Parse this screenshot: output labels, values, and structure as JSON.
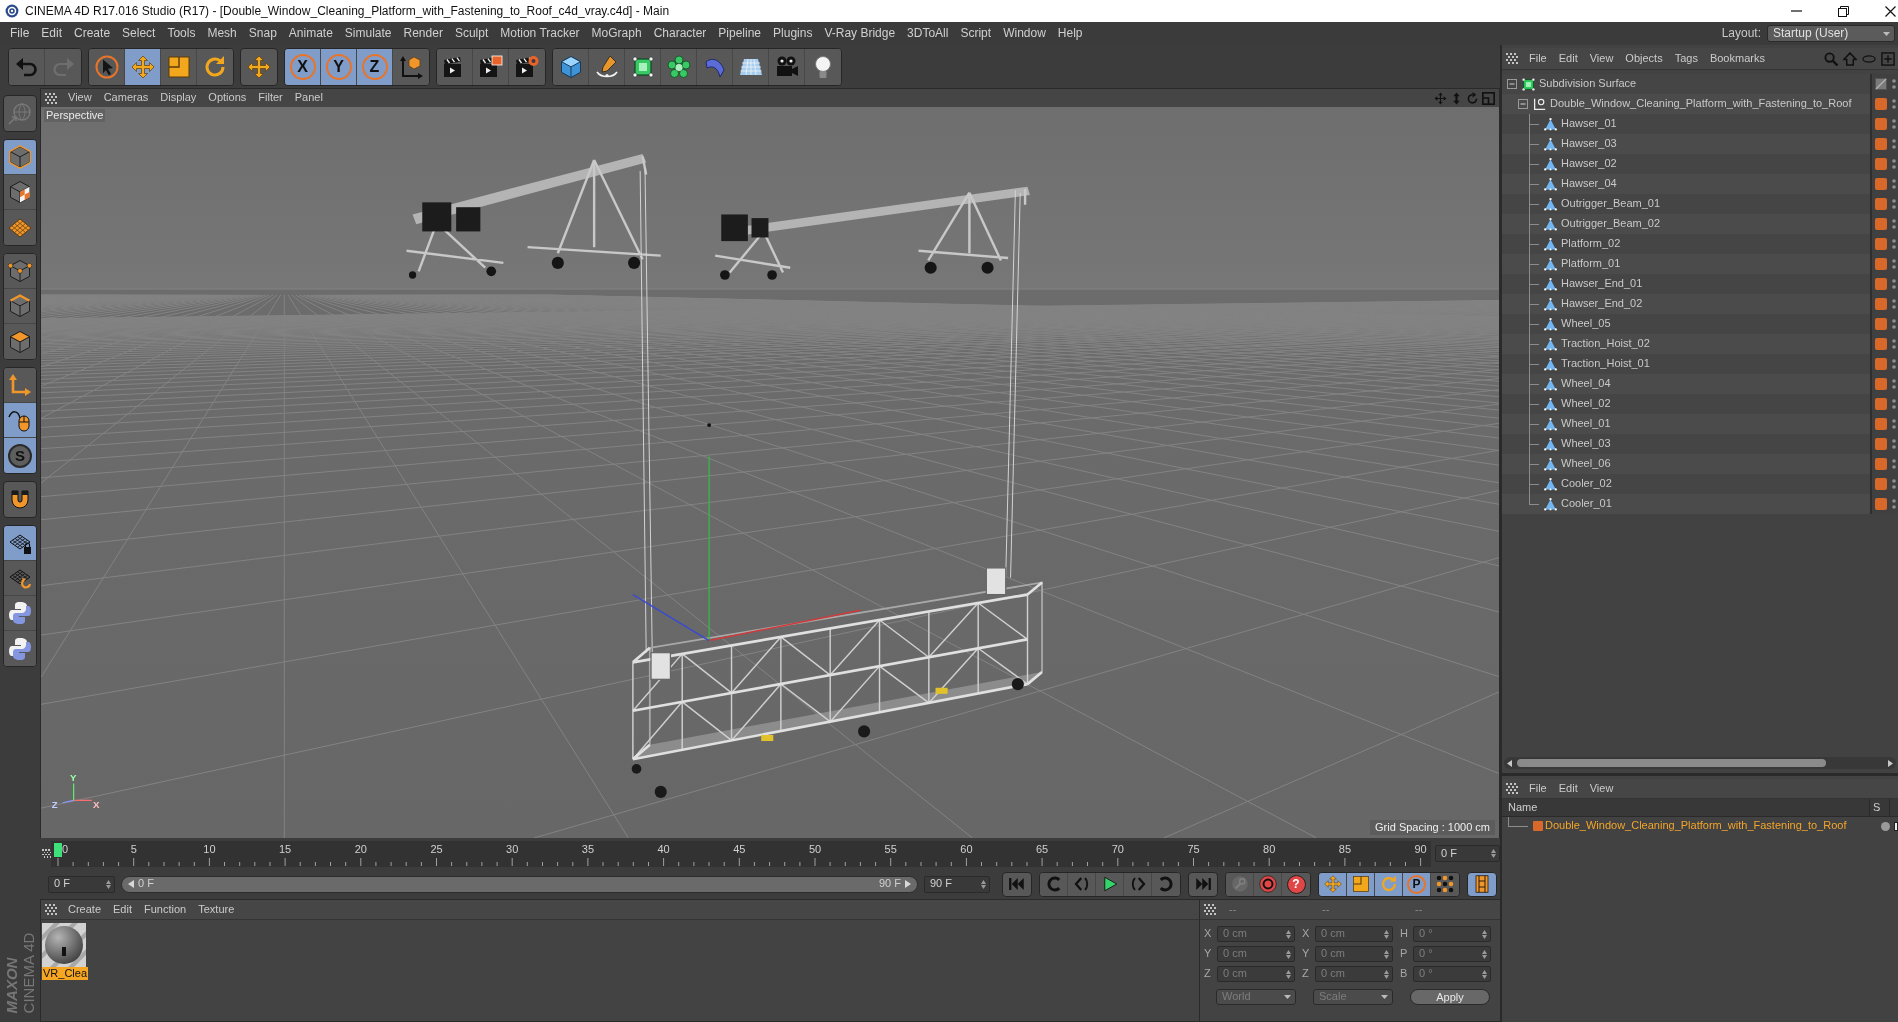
{
  "window": {
    "title": "CINEMA 4D R17.016 Studio (R17) - [Double_Window_Cleaning_Platform_with_Fastening_to_Roof_c4d_vray.c4d] - Main"
  },
  "menu_bar": {
    "items": [
      "File",
      "Edit",
      "Create",
      "Select",
      "Tools",
      "Mesh",
      "Snap",
      "Animate",
      "Simulate",
      "Render",
      "Sculpt",
      "Motion Tracker",
      "MoGraph",
      "Character",
      "Pipeline",
      "Plugins",
      "V-Ray Bridge",
      "3DToAll",
      "Script",
      "Window",
      "Help"
    ],
    "layout_label": "Layout:",
    "layout_value": "Startup (User)"
  },
  "toolbar": [
    {
      "buttons": [
        {
          "disabled": false
        },
        {
          "disabled": true
        }
      ]
    },
    {
      "buttons": [
        {
          "selected": false
        },
        {
          "selected": true
        },
        {
          "selected": false
        },
        {
          "selected": false
        }
      ]
    },
    {
      "buttons": [
        {
          "selected": false
        }
      ]
    },
    {
      "buttons": [
        {
          "label": "X",
          "selected": true
        },
        {
          "label": "Y",
          "selected": true
        },
        {
          "label": "Z",
          "selected": true
        },
        {
          "selected": false
        }
      ]
    },
    {
      "buttons": [
        {
          "selected": false
        },
        {
          "selected": false
        },
        {
          "selected": false
        }
      ]
    },
    {
      "buttons": [
        {
          "selected": false
        },
        {
          "selected": false
        },
        {
          "selected": false
        },
        {
          "selected": false
        },
        {
          "selected": false
        },
        {
          "selected": false
        },
        {
          "selected": false
        },
        {
          "selected": false
        }
      ]
    }
  ],
  "mode_toolbar": [
    {
      "buttons": [
        {
          "disabled": true
        }
      ]
    },
    {
      "buttons": [
        {
          "selected": true
        },
        {
          "selected": false
        },
        {
          "selected": false
        }
      ]
    },
    {
      "buttons": [
        {
          "selected": false
        },
        {
          "selected": false
        },
        {
          "selected": false
        }
      ]
    },
    {
      "buttons": [
        {
          "selected": false
        },
        {
          "selected": true
        },
        {
          "label": "S",
          "selected": true
        }
      ]
    },
    {
      "buttons": [
        {
          "selected": false
        }
      ]
    },
    {
      "buttons": [
        {
          "selected": true
        },
        {
          "selected": false
        },
        {
          "selected": false
        },
        {
          "selected": false
        }
      ]
    }
  ],
  "viewport": {
    "menu": [
      "View",
      "Cameras",
      "Display",
      "Options",
      "Filter",
      "Panel"
    ],
    "camera": "Perspective",
    "grid_spacing": "Grid Spacing : 1000 cm",
    "axis_labels": [
      "Y",
      "Z",
      "X"
    ]
  },
  "timeline": {
    "ticks": [
      "0",
      "5",
      "10",
      "15",
      "20",
      "25",
      "30",
      "35",
      "40",
      "45",
      "50",
      "55",
      "60",
      "65",
      "70",
      "75",
      "80",
      "85",
      "90"
    ],
    "playhead": {
      "level": 0
    },
    "current": "0 F"
  },
  "transport": {
    "start": "0 F",
    "range": {
      "start": "0 F",
      "end": "90 F"
    },
    "end": "90 F",
    "groups": [
      {
        "buttons": [
          {
            "selected": false
          }
        ]
      },
      {
        "buttons": [
          {
            "selected": false
          },
          {
            "selected": false
          },
          {
            "selected": false
          },
          {
            "selected": false
          },
          {
            "selected": false
          }
        ]
      },
      {
        "buttons": [
          {
            "selected": false
          }
        ]
      },
      {
        "buttons": [
          {
            "disabled": true
          },
          {
            "disabled": false
          },
          {
            "label": "?",
            "disabled": false
          }
        ]
      },
      {
        "buttons": [
          {
            "selected": true
          },
          {
            "selected": true
          },
          {
            "selected": true
          },
          {
            "label": "P",
            "selected": true
          },
          {
            "selected": false
          }
        ]
      },
      {
        "buttons": [
          {
            "selected": true
          }
        ]
      }
    ]
  },
  "material_manager": {
    "menu": [
      "Create",
      "Edit",
      "Function",
      "Texture"
    ],
    "materials": [
      {
        "name": "VR_Clea",
        "selected": true
      }
    ]
  },
  "coordinates": {
    "headers": [
      "--",
      "--",
      "--"
    ],
    "rows": [
      {
        "cells": [
          {
            "axis": "X",
            "value": "0 cm"
          },
          {
            "axis": "X",
            "value": "0 cm"
          },
          {
            "axis": "H",
            "value": "0 °"
          }
        ]
      },
      {
        "cells": [
          {
            "axis": "Y",
            "value": "0 cm"
          },
          {
            "axis": "Y",
            "value": "0 cm"
          },
          {
            "axis": "P",
            "value": "0 °"
          }
        ]
      },
      {
        "cells": [
          {
            "axis": "Z",
            "value": "0 cm"
          },
          {
            "axis": "Z",
            "value": "0 cm"
          },
          {
            "axis": "B",
            "value": "0 °"
          }
        ]
      }
    ],
    "modes": [
      "World",
      "Scale"
    ],
    "apply": "Apply"
  },
  "logo": {
    "brand": "MAXON",
    "product": "CINEMA 4D"
  },
  "object_manager": {
    "menu": [
      "File",
      "Edit",
      "View",
      "Objects",
      "Tags",
      "Bookmarks"
    ],
    "objects": [
      {
        "name": "Subdivision Surface",
        "kind": "generator",
        "expanded": true,
        "layer": false,
        "children": [
          {
            "name": "Double_Window_Cleaning_Platform_with_Fastening_to_Roof",
            "kind": "null",
            "expanded": true,
            "layer": true,
            "children": [
              {
                "name": "Hawser_01",
                "kind": "mesh",
                "layer": true
              },
              {
                "name": "Hawser_03",
                "kind": "mesh",
                "layer": true
              },
              {
                "name": "Hawser_02",
                "kind": "mesh",
                "layer": true
              },
              {
                "name": "Hawser_04",
                "kind": "mesh",
                "layer": true
              },
              {
                "name": "Outrigger_Beam_01",
                "kind": "mesh",
                "layer": true
              },
              {
                "name": "Outrigger_Beam_02",
                "kind": "mesh",
                "layer": true
              },
              {
                "name": "Platform_02",
                "kind": "mesh",
                "layer": true
              },
              {
                "name": "Platform_01",
                "kind": "mesh",
                "layer": true
              },
              {
                "name": "Hawser_End_01",
                "kind": "mesh",
                "layer": true
              },
              {
                "name": "Hawser_End_02",
                "kind": "mesh",
                "layer": true
              },
              {
                "name": "Wheel_05",
                "kind": "mesh",
                "layer": true
              },
              {
                "name": "Traction_Hoist_02",
                "kind": "mesh",
                "layer": true
              },
              {
                "name": "Traction_Hoist_01",
                "kind": "mesh",
                "layer": true
              },
              {
                "name": "Wheel_04",
                "kind": "mesh",
                "layer": true
              },
              {
                "name": "Wheel_02",
                "kind": "mesh",
                "layer": true
              },
              {
                "name": "Wheel_01",
                "kind": "mesh",
                "layer": true
              },
              {
                "name": "Wheel_03",
                "kind": "mesh",
                "layer": true
              },
              {
                "name": "Wheel_06",
                "kind": "mesh",
                "layer": true
              },
              {
                "name": "Cooler_02",
                "kind": "mesh",
                "layer": true
              },
              {
                "name": "Cooler_01",
                "kind": "mesh",
                "layer": true
              }
            ]
          }
        ]
      }
    ]
  },
  "layer_manager": {
    "menu": [
      "File",
      "Edit",
      "View"
    ],
    "columns": [
      "Name",
      "S"
    ],
    "layers": [
      {
        "name": "Double_Window_Cleaning_Platform_with_Fastening_to_Roof",
        "color": "#d9692a",
        "selected": true
      }
    ]
  }
}
